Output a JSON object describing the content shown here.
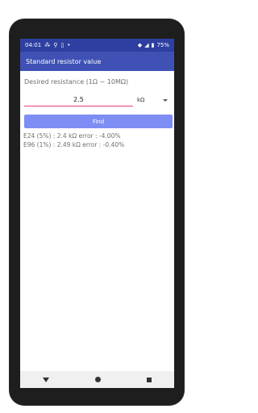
{
  "status": {
    "time": "04:01",
    "battery": "75%"
  },
  "appbar": {
    "title": "Standard resistor value"
  },
  "form": {
    "label": "Desired resistance (1Ω ~ 10MΩ)",
    "value": "2.5",
    "unit": "kΩ",
    "find_label": "Find"
  },
  "results": [
    "E24 (5%) : 2.4 kΩ   error : -4.00%",
    "E96 (1%) : 2.49 kΩ   error : -0.40%"
  ]
}
